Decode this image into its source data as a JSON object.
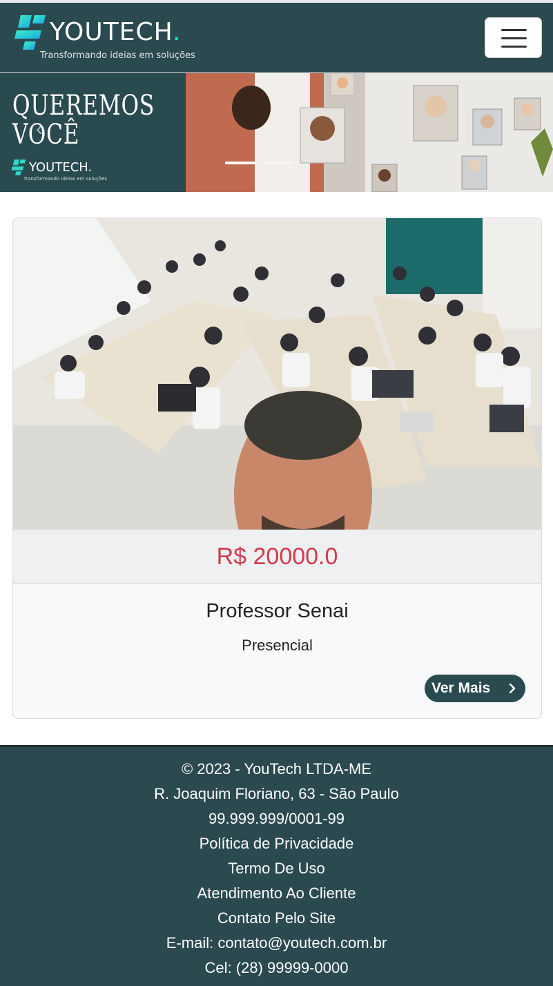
{
  "brand": {
    "name": "YOUTECH",
    "dot": ".",
    "tagline": "Transformando ideias em soluções",
    "accent_color": "#1de9b6",
    "primary_color": "#2a4a4f"
  },
  "navbar": {
    "toggler_icon": "hamburger-icon"
  },
  "banner": {
    "headline_line1": "QUEREMOS",
    "headline_line2": "VOCÊ",
    "logo_name": "YOUTECH.",
    "logo_tagline": "Transformando ideias em soluções",
    "prev_icon": "chevron-left-icon",
    "indicators": 2
  },
  "card": {
    "price": "R$ 20000.0",
    "title": "Professor Senai",
    "subtitle": "Presencial",
    "button_label": "Ver Mais",
    "button_icon": "chevron-right-icon",
    "price_color": "#d23b4a"
  },
  "footer": {
    "copyright": "© 2023 - YouTech LTDA-ME",
    "address": "R. Joaquim Floriano, 63 - São Paulo",
    "cnpj": "99.999.999/0001-99",
    "privacy": "Política de Privacidade",
    "terms": "Termo De Uso",
    "support": "Atendimento Ao Cliente",
    "contact": "Contato Pelo Site",
    "email": "E-mail: contato@youtech.com.br",
    "phone": "Cel: (28) 99999-0000"
  }
}
